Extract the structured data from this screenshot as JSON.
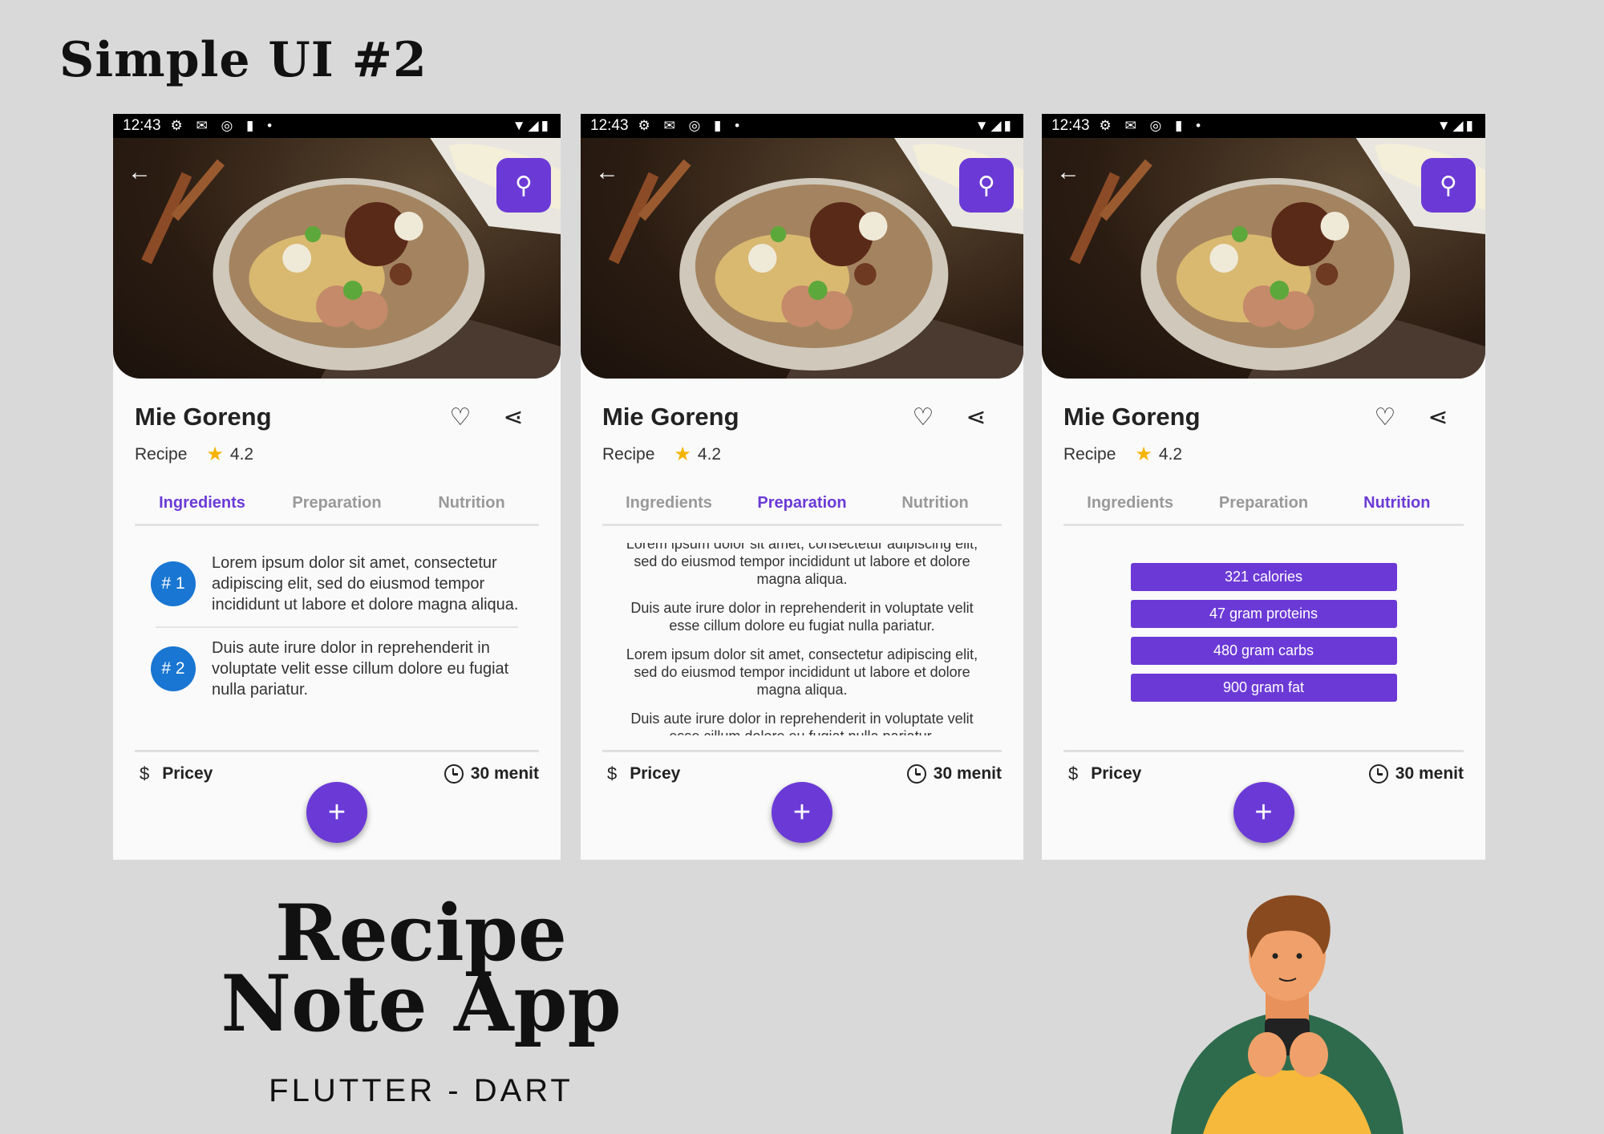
{
  "heading": "Simple UI #2",
  "app_title": "Recipe Note App",
  "app_subtitle": "FLUTTER - DART",
  "accent_color": "#6b3ad6",
  "badge_color": "#1976d2",
  "star_color": "#f5b301",
  "status_bar": {
    "time": "12:43",
    "left_icons": "⚙ ✉ ◎ ▮ •",
    "right_icons": "▼◢▮"
  },
  "recipe": {
    "title": "Mie Goreng",
    "category": "Recipe",
    "rating": "4.2",
    "price": "Pricey",
    "duration": "30 menit"
  },
  "icons": {
    "back": "back-arrow-icon",
    "search": "search-icon",
    "favorite": "heart-icon",
    "share": "share-icon",
    "price": "dollar-icon",
    "time": "clock-icon",
    "add": "plus-icon",
    "rating": "star-icon"
  },
  "tabs": [
    "Ingredients",
    "Preparation",
    "Nutrition"
  ],
  "screens": [
    {
      "active_tab": "Ingredients"
    },
    {
      "active_tab": "Preparation"
    },
    {
      "active_tab": "Nutrition"
    }
  ],
  "ingredients": [
    {
      "badge": "# 1",
      "text": "Lorem ipsum dolor sit amet, consectetur adipiscing elit, sed do eiusmod tempor incididunt ut labore et dolore magna aliqua."
    },
    {
      "badge": "# 2",
      "text": "Duis aute irure dolor in reprehenderit in voluptate velit esse cillum dolore eu fugiat nulla pariatur."
    }
  ],
  "preparation": [
    "Lorem ipsum dolor sit amet, consectetur adipiscing elit, sed do eiusmod tempor incididunt ut labore et dolore magna aliqua.",
    "Duis aute irure dolor in reprehenderit in voluptate velit esse cillum dolore eu fugiat nulla pariatur.",
    "Lorem ipsum dolor sit amet, consectetur adipiscing elit, sed do eiusmod tempor incididunt ut labore et dolore magna aliqua.",
    "Duis aute irure dolor in reprehenderit in voluptate velit esse cillum dolore eu fugiat nulla pariatur."
  ],
  "nutrition": [
    "321 calories",
    "47 gram proteins",
    "480 gram carbs",
    "900 gram fat"
  ],
  "glyphs": {
    "back": "←",
    "search": "⚲",
    "heart": "♡",
    "share": "⋖",
    "dollar": "$",
    "plus": "+",
    "star": "★"
  }
}
